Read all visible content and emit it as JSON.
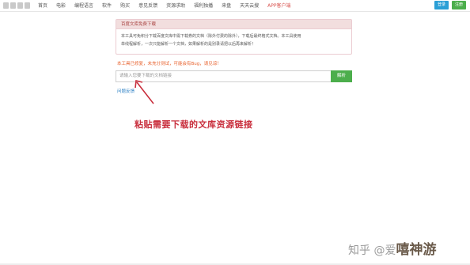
{
  "nav": {
    "items": [
      "首页",
      "电影",
      "编程语言",
      "软件",
      "购买",
      "意见反馈",
      "资源求助",
      "福利独播",
      "来盘",
      "天天云搜",
      "APP客户端"
    ],
    "highlight_index": 10,
    "login_label": "登录",
    "register_label": "注册"
  },
  "panel": {
    "title": "百度文库免费下载",
    "lines": [
      "本工具可免积分下载百度文库中需下载券的文档（除外付费的除外），下载后最终格式文档。本工具使用",
      "单线程解析，一次只能解析一个文档，如果解析的是别录请把以后再来解析！"
    ]
  },
  "notice": "本工具已修复，未充分测试，可能会有Bug，请见谅！",
  "input": {
    "placeholder": "请输入您要下载的文档链接",
    "button_label": "解析"
  },
  "feedback_link": "问题反馈",
  "caption": "粘贴需要下载的文库资源链接",
  "watermark": {
    "text": "知乎 @爱",
    "brand": "嘻神游"
  },
  "colors": {
    "caption_red": "#c9303e",
    "notice_orange": "#e8612c",
    "parse_green": "#4cae4c",
    "login_blue": "#2a9fd6",
    "panel_bg": "#f2dede"
  }
}
